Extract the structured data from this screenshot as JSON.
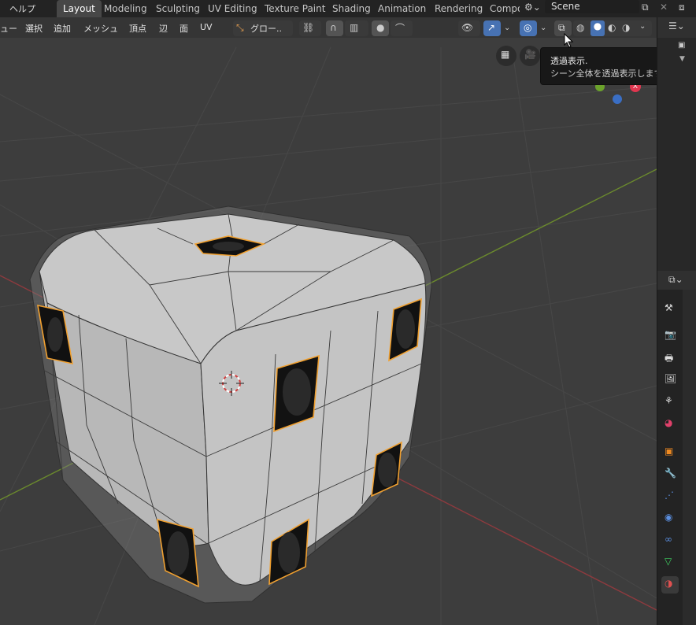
{
  "topbar": {
    "help_menu": "ヘルプ",
    "workspaces": [
      "Layout",
      "Modeling",
      "Sculpting",
      "UV Editing",
      "Texture Paint",
      "Shading",
      "Animation",
      "Rendering",
      "Compo"
    ],
    "active_workspace": "Layout",
    "scene_name": "Scene"
  },
  "viewport_header": {
    "menus": [
      "ュー",
      "選択",
      "追加",
      "メッシュ",
      "頂点",
      "辺",
      "面",
      "UV"
    ],
    "transform_orientation": "グロー..",
    "icons": [
      "proportional-edit-icon",
      "snap-icon",
      "xray-icon",
      "wireframe-shading-icon",
      "solid-shading-icon",
      "material-shading-icon",
      "rendered-shading-icon"
    ]
  },
  "tooltip": {
    "title": "透過表示.",
    "description": "シーン全体を透過表示します."
  },
  "gizmo": {
    "x_label": "X",
    "colors": {
      "x": "#e0364f",
      "y": "#6ba22b",
      "z": "#3a6ec4"
    }
  },
  "colors": {
    "accent": "#4772b3",
    "selection_edge": "#f0a030",
    "background": "#3d3d3d",
    "grid": "#4a4a4a"
  }
}
